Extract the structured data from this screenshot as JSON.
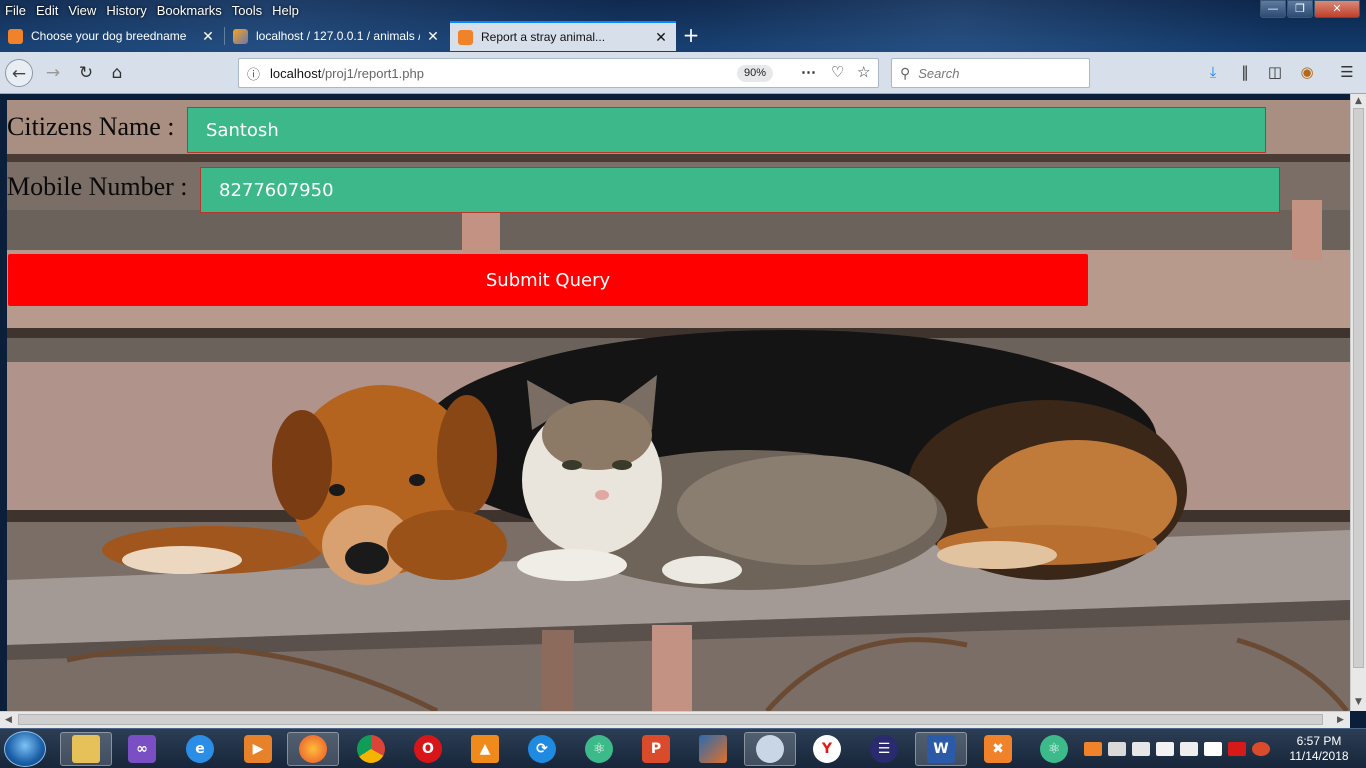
{
  "menubar": {
    "items": [
      "File",
      "Edit",
      "View",
      "History",
      "Bookmarks",
      "Tools",
      "Help"
    ]
  },
  "tabs": [
    {
      "title": "Choose your dog breedname",
      "active": false
    },
    {
      "title": "localhost / 127.0.0.1 / animals /",
      "active": false
    },
    {
      "title": "Report a stray animal...",
      "active": true
    }
  ],
  "navbar": {
    "url_host": "localhost",
    "url_path": "/proj1/report1.php",
    "zoom": "90%",
    "search_placeholder": "Search"
  },
  "form": {
    "name_label": "Citizens Name :",
    "name_value": "Santosh",
    "mobile_label": "Mobile Number :",
    "mobile_value": "8277607950",
    "submit_label": "Submit Query"
  },
  "clock": {
    "time": "6:57 PM",
    "date": "11/14/2018"
  },
  "taskbar": {
    "apps": [
      "file-explorer",
      "visual-studio",
      "internet-explorer",
      "media-player",
      "firefox",
      "chrome",
      "opera",
      "vlc",
      "app-settings",
      "atom",
      "postman",
      "matlab",
      "snipping-tool",
      "yandex",
      "eclipse",
      "word",
      "xampp",
      "atom-2"
    ]
  },
  "colors": {
    "input_bg": "#3cb88a",
    "submit_bg": "#ff0000",
    "active_tab_border": "#0a84ff"
  }
}
